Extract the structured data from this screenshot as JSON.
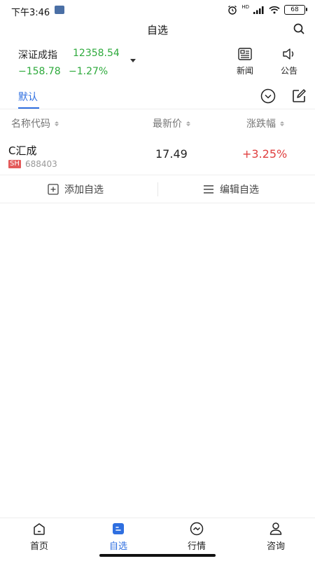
{
  "status_bar": {
    "time": "下午3:46",
    "network_label": "HD",
    "battery": "68"
  },
  "header": {
    "title": "自选"
  },
  "index": {
    "name": "深证成指",
    "value": "12358.54",
    "change": "−158.78",
    "change_pct": "−1.27%",
    "color": "#2eaa3c"
  },
  "tools": [
    {
      "label": "新闻",
      "icon": "news-icon"
    },
    {
      "label": "公告",
      "icon": "speaker-icon"
    }
  ],
  "tabs": {
    "active": "默认",
    "accent": "#2f6fe0"
  },
  "columns": [
    "名称代码",
    "最新价",
    "涨跌幅"
  ],
  "stocks": [
    {
      "name": "C汇成",
      "market": "SH",
      "code": "688403",
      "price": "17.49",
      "change_pct": "+3.25%",
      "change_color": "#e04040"
    }
  ],
  "actions": {
    "add": "添加自选",
    "edit": "编辑自选"
  },
  "bottom_nav": [
    {
      "label": "首页",
      "icon": "home-icon"
    },
    {
      "label": "自选",
      "icon": "watchlist-icon",
      "active": true
    },
    {
      "label": "行情",
      "icon": "market-icon"
    },
    {
      "label": "咨询",
      "icon": "profile-icon"
    }
  ]
}
